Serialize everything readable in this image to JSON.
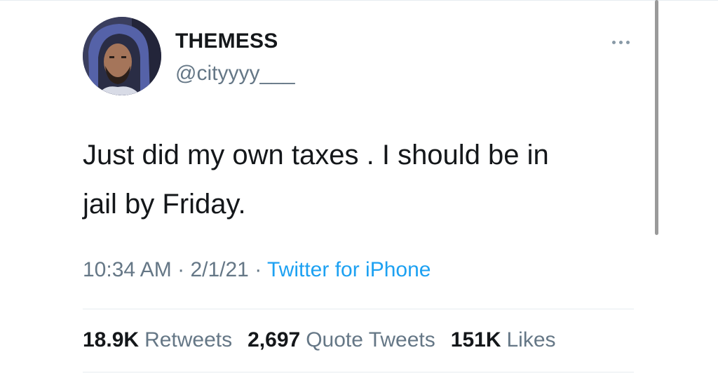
{
  "user": {
    "display_name": "THEMESS",
    "handle": "@cityyyy___"
  },
  "tweet": {
    "text_line1": "Just did my own taxes . I should be in",
    "text_line2": "jail by Friday.",
    "time": "10:34 AM",
    "separator": "·",
    "date": "2/1/21",
    "source": "Twitter for iPhone"
  },
  "stats": {
    "retweets_count": "18.9K",
    "retweets_label": "Retweets",
    "quotes_count": "2,697",
    "quotes_label": "Quote Tweets",
    "likes_count": "151K",
    "likes_label": "Likes"
  },
  "icons": {
    "more": "more-horizontal-icon",
    "avatar": "user-avatar"
  },
  "colors": {
    "text_primary": "#14171a",
    "text_secondary": "#657786",
    "link": "#1da1f2",
    "divider": "#e6ecf0"
  }
}
